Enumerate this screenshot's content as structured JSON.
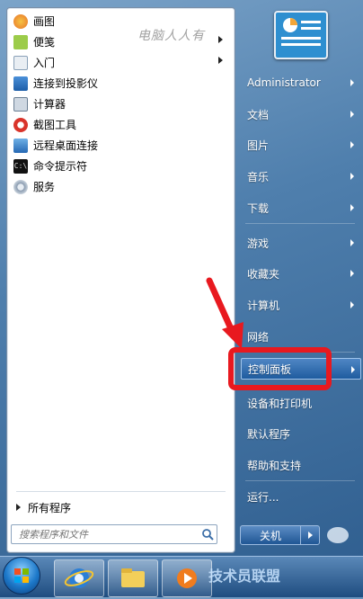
{
  "watermark_text": "电脑人人有",
  "programs": [
    {
      "label": "画图",
      "arrow": false,
      "icon": "paint-icon"
    },
    {
      "label": "便笺",
      "arrow": true,
      "icon": "sticky-notes-icon"
    },
    {
      "label": "入门",
      "arrow": true,
      "icon": "getting-started-icon"
    },
    {
      "label": "连接到投影仪",
      "arrow": false,
      "icon": "projector-icon"
    },
    {
      "label": "计算器",
      "arrow": false,
      "icon": "calculator-icon"
    },
    {
      "label": "截图工具",
      "arrow": false,
      "icon": "snipping-tool-icon"
    },
    {
      "label": "远程桌面连接",
      "arrow": false,
      "icon": "remote-desktop-icon"
    },
    {
      "label": "命令提示符",
      "arrow": false,
      "icon": "command-prompt-icon"
    },
    {
      "label": "服务",
      "arrow": false,
      "icon": "services-icon"
    }
  ],
  "all_programs_label": "所有程序",
  "search": {
    "placeholder": "搜索程序和文件"
  },
  "right_items": [
    {
      "label": "Administrator",
      "arrow": true
    },
    {
      "label": "文档",
      "arrow": true
    },
    {
      "label": "图片",
      "arrow": true
    },
    {
      "label": "音乐",
      "arrow": true
    },
    {
      "label": "下载",
      "arrow": true
    },
    {
      "label": "游戏",
      "arrow": true
    },
    {
      "label": "收藏夹",
      "arrow": true
    },
    {
      "label": "计算机",
      "arrow": true
    },
    {
      "label": "网络",
      "arrow": false
    },
    {
      "label": "控制面板",
      "arrow": true
    },
    {
      "label": "设备和打印机",
      "arrow": false
    },
    {
      "label": "默认程序",
      "arrow": false
    },
    {
      "label": "帮助和支持",
      "arrow": false
    },
    {
      "label": "运行...",
      "arrow": false
    }
  ],
  "shutdown_label": "关机",
  "taskbar_watermark": "技术员联盟",
  "colors": {
    "highlight": "#e8191f",
    "menu_blue": "#2e5d8e"
  }
}
